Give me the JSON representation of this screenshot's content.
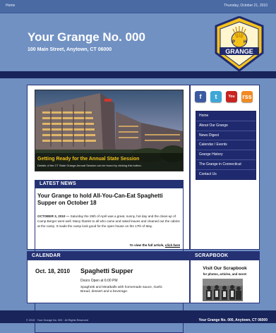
{
  "topbar": {
    "home": "Home",
    "date": "Thursday, October 21, 2010"
  },
  "header": {
    "title": "Your Grange No. 000",
    "address": "100 Main Street, Anytown, CT 06000",
    "logo_letters": [
      "P",
      "H",
      "GRANGE"
    ]
  },
  "hero": {
    "title": "Getting Ready for the Annual State Session",
    "caption": "Details of the CT State Grange Annual Session can be found by clicking this button."
  },
  "news": {
    "section": "LATEST NEWS",
    "headline": "Your Grange to hold All-You-Can-Eat Spaghetti Supper on October 18",
    "dateline": "OCTOBER 3, 2010 —",
    "body": " Saturday the 25th of April was a great, sunny, hot day and the clean-up of Camp Berger went well. Many thanks to all who came and raked leaves and cleaned out the cabins at the camp. It made the camp look good for the open house on the 17th of May.",
    "more_prefix": "To view the full article, ",
    "more_link": "click here"
  },
  "social": [
    "f",
    "t",
    "You Tube",
    "rss"
  ],
  "menu": [
    "Home",
    "About Our Grange",
    "News Digest",
    "Calendar / Events",
    "Grange History",
    "The Grange in Connecticut",
    "Contact Us"
  ],
  "calendar": {
    "section": "CALENDAR",
    "date": "Oct. 18, 2010",
    "event": "Spaghetti Supper",
    "doors": "Doors Open at 6:00 PM",
    "description": "Spaghetti and Meatballs with homemade sauce, Garlic Bread, dessert and a beverage."
  },
  "scrapbook": {
    "section": "SCRAPBOOK",
    "title": "Visit Our Scrapbook",
    "subtitle": "for photos, articles, and more!"
  },
  "footer": {
    "left": "© 2010 · Your Grange No. 000 · All Rights Reserved",
    "right": "Your Grange No. 000, Anytown, CT  06000"
  },
  "colors": {
    "page_blue": "#6f8fc0",
    "navy": "#18245a",
    "section_bar": "#243273",
    "hero_title": "#f2c21c",
    "logo_gold": "#f5c21b"
  }
}
